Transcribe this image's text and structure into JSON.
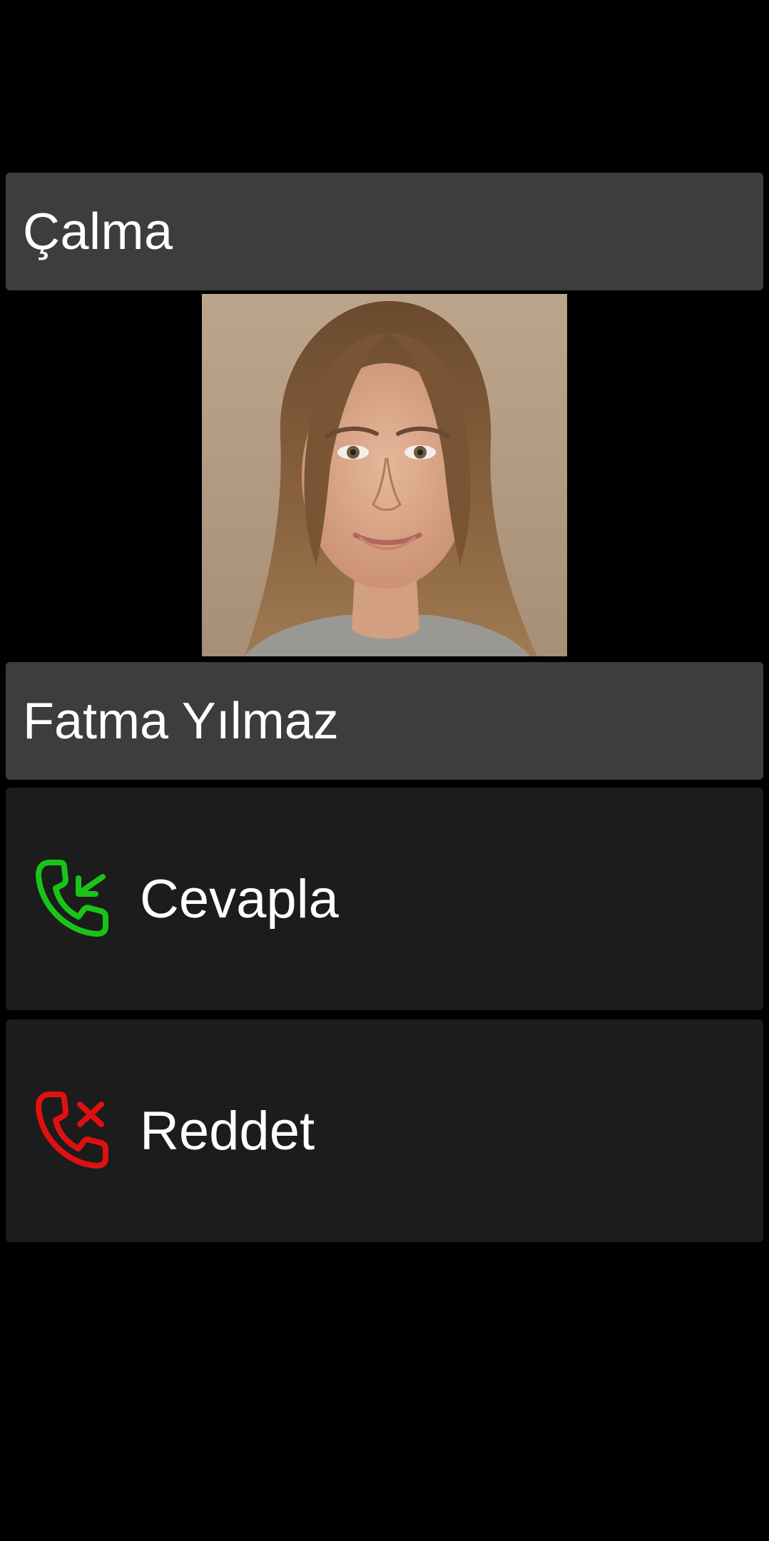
{
  "call": {
    "state_label": "Çalma",
    "caller_name": "Fatma Yılmaz",
    "caller_photo_alt": "caller-photo"
  },
  "actions": {
    "answer": {
      "label": "Cevapla",
      "icon": "phone-incoming-icon",
      "color": "#19c419"
    },
    "reject": {
      "label": "Reddet",
      "icon": "phone-reject-icon",
      "color": "#e01010"
    }
  },
  "colors": {
    "background": "#000000",
    "header_panel": "#3d3d3d",
    "action_panel": "#1c1c1c",
    "text": "#ffffff"
  }
}
